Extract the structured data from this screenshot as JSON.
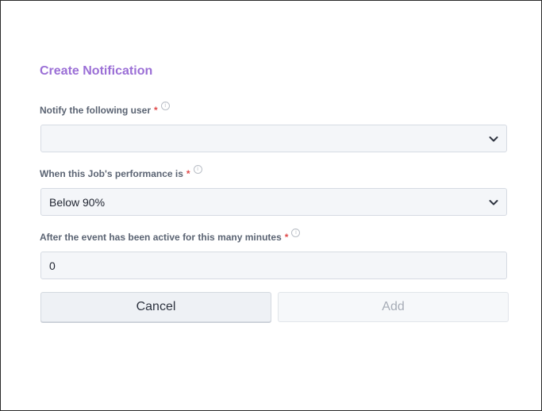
{
  "dialog": {
    "title": "Create Notification",
    "user_field": {
      "label": "Notify the following user",
      "required_mark": "*",
      "info_glyph": "i",
      "value": ""
    },
    "performance_field": {
      "label": "When this Job's performance is",
      "required_mark": "*",
      "info_glyph": "i",
      "value": "Below 90%"
    },
    "minutes_field": {
      "label": "After the event has been active for this many minutes",
      "required_mark": "*",
      "info_glyph": "i",
      "value": "0"
    },
    "buttons": {
      "cancel": "Cancel",
      "add": "Add"
    }
  },
  "colors": {
    "title": "#9b6fd6",
    "required": "#e04a4a",
    "field_bg": "#f4f6f9"
  },
  "icons": {
    "dropdown": "chevron-down-icon",
    "info": "info-icon"
  }
}
